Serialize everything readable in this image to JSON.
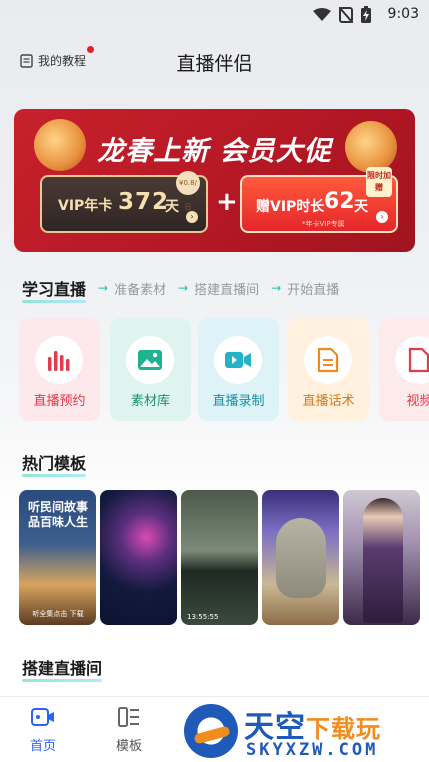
{
  "status_bar": {
    "time": "9:03",
    "icons": [
      "wifi-icon",
      "no-sim-icon",
      "battery-charging-icon"
    ]
  },
  "header": {
    "tutorial_label": "我的教程",
    "title": "直播伴侣"
  },
  "banner": {
    "title": "龙春上新 会员大促",
    "vip_card": {
      "label": "VIP年卡",
      "number": "372",
      "unit": "天",
      "tag": "¥0.8/日"
    },
    "plus": "+",
    "gift_card": {
      "label": "赠VIP时长",
      "number": "62",
      "unit": "天",
      "sub": "*年卡VIP专属",
      "tag": "限时加赠"
    },
    "colors": {
      "background": "#c7212c",
      "gold": "#e8c890"
    }
  },
  "learning": {
    "title": "学习直播",
    "steps": [
      "准备素材",
      "搭建直播间",
      "开始直播"
    ]
  },
  "tools": [
    {
      "label": "直播预约",
      "icon": "bar-chart-icon",
      "color": "#e23b4b"
    },
    {
      "label": "素材库",
      "icon": "image-icon",
      "color": "#1fb28f"
    },
    {
      "label": "直播录制",
      "icon": "video-camera-icon",
      "color": "#22b3c6"
    },
    {
      "label": "直播话术",
      "icon": "document-icon",
      "color": "#f08a1e"
    },
    {
      "label": "视频",
      "icon": "document-icon",
      "color": "#e23b4b"
    }
  ],
  "hot_templates": {
    "title": "热门模板",
    "items": [
      {
        "text": "听民间故事品百味人生",
        "footer": "听全集点击 下载"
      },
      {
        "text": ""
      },
      {
        "text": "",
        "time": "13:55:55"
      },
      {
        "text": ""
      },
      {
        "text": ""
      }
    ]
  },
  "build_room": {
    "title": "搭建直播间"
  },
  "bottom_nav": {
    "home": "首页",
    "templates": "模板",
    "active_color": "#2b63f3"
  },
  "watermark": {
    "cn_main": "天空",
    "cn_sub": "下载玩",
    "en": "SKYXZW.COM"
  }
}
